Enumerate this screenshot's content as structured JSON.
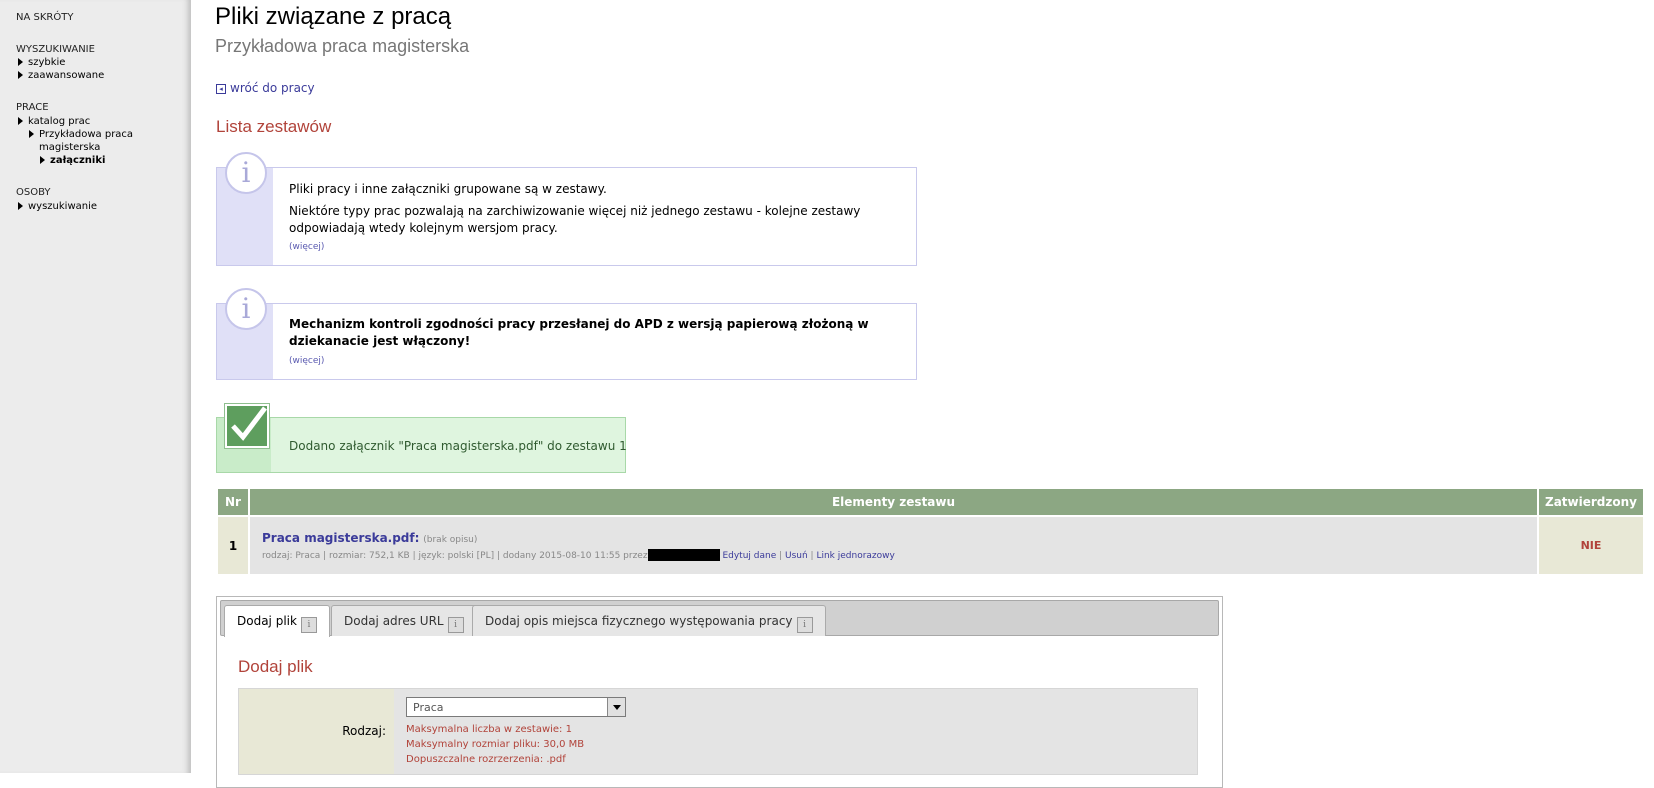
{
  "sidebar": {
    "shortcuts": "NA SKRÓTY",
    "search_head": "WYSZUKIWANIE",
    "search_items": [
      "szybkie",
      "zaawansowane"
    ],
    "theses_head": "PRACE",
    "catalog": "katalog prac",
    "thesis_line1": "Przykładowa praca",
    "thesis_line2": "magisterska",
    "attachments": "załączniki",
    "people_head": "OSOBY",
    "people_search": "wyszukiwanie"
  },
  "header": {
    "title": "Pliki związane z pracą",
    "subtitle": "Przykładowa praca magisterska",
    "back_link": "wróć do pracy"
  },
  "sets": {
    "title": "Lista zestawów",
    "info1_line1": "Pliki pracy i inne załączniki grupowane są w zestawy.",
    "info1_line2": "Niektóre typy prac pozwalają na zarchiwizowanie więcej niż jednego zestawu - kolejne zestawy odpowiadają wtedy kolejnym wersjom pracy.",
    "info1_more": "(więcej)",
    "info2_text": "Mechanizm kontroli zgodności pracy przesłanej do APD z wersją papierową złożoną w dziekanacie jest włączony!",
    "info2_more": "(więcej)",
    "success": "Dodano załącznik \"Praca magisterska.pdf\" do zestawu 1"
  },
  "table": {
    "headers": {
      "nr": "Nr",
      "elements": "Elementy zestawu",
      "confirmed": "Zatwierdzony"
    },
    "row": {
      "nr": "1",
      "file_name": "Praca magisterska.pdf:",
      "description": "(brak opisu)",
      "meta": "rodzaj: Praca | rozmiar: 752,1 KB | język: polski [PL] | dodany 2015-08-10 11:55 przez",
      "edit": "Edytuj dane",
      "delete": "Usuń",
      "onetime_link": "Link jednorazowy",
      "confirmed": "NIE"
    }
  },
  "tabs": [
    "Dodaj plik",
    "Dodaj adres URL",
    "Dodaj opis miejsca fizycznego występowania pracy"
  ],
  "tab_info_glyph": "i",
  "form": {
    "title": "Dodaj plik",
    "type_label": "Rodzaj:",
    "type_value": "Praca",
    "hint1": "Maksymalna liczba w zestawie: 1",
    "hint2": "Maksymalny rozmiar pliku: 30,0 MB",
    "hint3": "Dopuszczalne rozrzerzenia: .pdf"
  },
  "colors": {
    "accent_red": "#b1433a",
    "link_blue": "#3b3b9a",
    "table_header": "#8ca783",
    "success_bg": "#dff5df",
    "info_band": "#e0e0f7"
  }
}
